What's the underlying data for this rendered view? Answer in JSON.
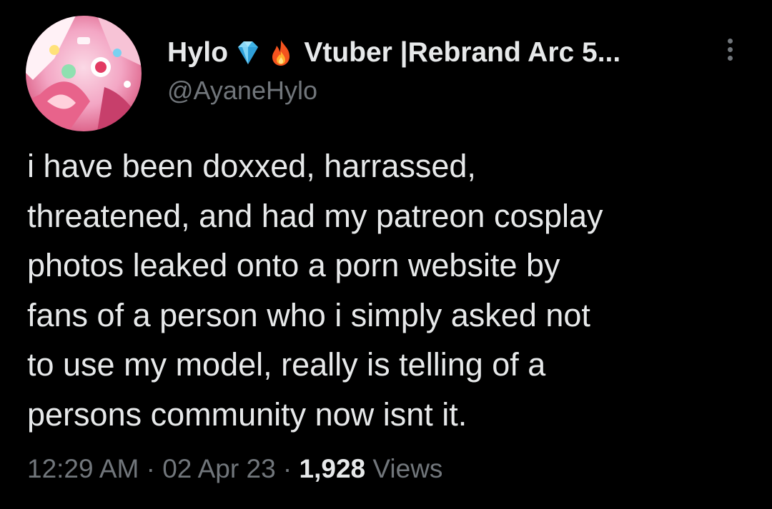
{
  "author": {
    "display_name": "Hylo",
    "badge_icons": [
      "gem-icon",
      "fire-icon"
    ],
    "bio_name": "Vtuber |Rebrand Arc 5...",
    "handle": "@AyaneHylo",
    "avatar_icon": "avatar-image"
  },
  "more_icon": "vertical-ellipsis-icon",
  "tweet": {
    "lines": [
      "i have been doxxed, harrassed,",
      "threatened, and had my patreon cosplay",
      "photos leaked onto a porn website by",
      "fans of a person who i simply asked not",
      "to use my model, really is telling of a",
      "persons community now isnt it."
    ]
  },
  "meta": {
    "time": "12:29 AM",
    "separator": "·",
    "date": "02 Apr 23",
    "views_count": "1,928",
    "views_label": "Views"
  },
  "colors": {
    "background": "#000000",
    "primary_text": "#e7e9ea",
    "secondary_text": "#71767b",
    "gem": "#5bc8f5",
    "fire": "#f4531e"
  }
}
